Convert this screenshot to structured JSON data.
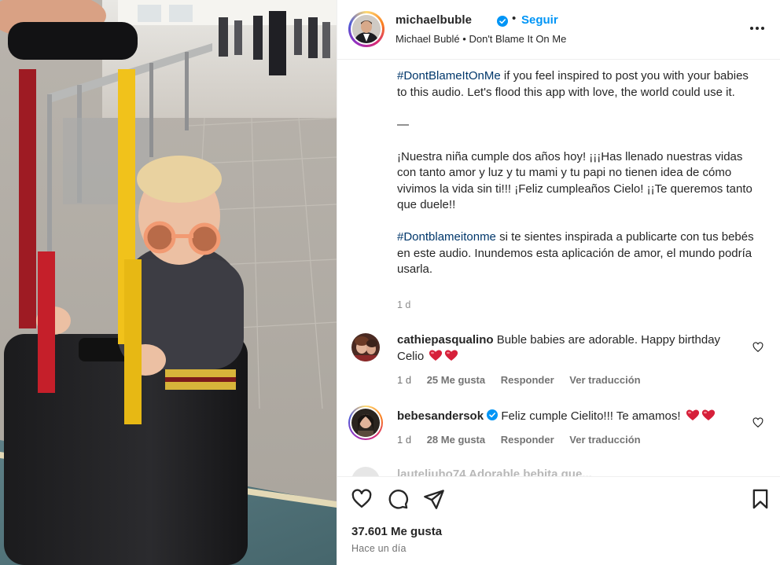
{
  "post": {
    "username": "michaelbuble",
    "separator": "•",
    "follow_label": "Seguir",
    "audio_artist": "Michael Bublé",
    "audio_separator": "•",
    "audio_title": "Don't Blame It On Me",
    "more_icon": "more-horizontal-icon"
  },
  "caption": {
    "p1_hashtag": "#DontBlameItOnMe",
    "p1_text": " if you feel inspired to post you with your babies to this audio. Let's flood this app with love, the world could use it.",
    "divider": "—",
    "p2_text": "¡Nuestra niña cumple dos años hoy! ¡¡¡Has llenado nuestras vidas con tanto amor y luz y tu mami y tu papi no tienen idea de cómo vivimos la vida sin ti!!! ¡Feliz cumpleaños Cielo! ¡¡Te queremos tanto que duele!!",
    "p3_hashtag": "#Dontblameitonme",
    "p3_text": " si te sientes inspirada a publicarte con tus bebés en este audio. Inundemos esta aplicación de amor, el mundo podría usarla.",
    "time": "1 d"
  },
  "comments": [
    {
      "username": "cathiepasqualino",
      "text": " Buble babies are adorable. Happy birthday Celio",
      "emoji": [
        "heart-icon",
        "heart-icon"
      ],
      "time": "1 d",
      "likes": "25 Me gusta",
      "reply": "Responder",
      "translate": "Ver traducción"
    },
    {
      "username": "bebesandersok",
      "text": " Feliz cumple Cielito!!! Te amamos! ",
      "emoji": [
        "heart-icon",
        "heart-icon"
      ],
      "time": "1 d",
      "likes": "28 Me gusta",
      "reply": "Responder",
      "translate": "Ver traducción"
    }
  ],
  "partial_comment": "lauteliuho74 Adorable bebita que...",
  "footer": {
    "likes": "37.601 Me gusta",
    "when": "Hace un día"
  },
  "colors": {
    "link_blue": "#0095f6",
    "hashtag_blue": "#00376b",
    "verified_blue": "#0095f6",
    "heart_red": "#e0245e",
    "muted": "#737373"
  }
}
